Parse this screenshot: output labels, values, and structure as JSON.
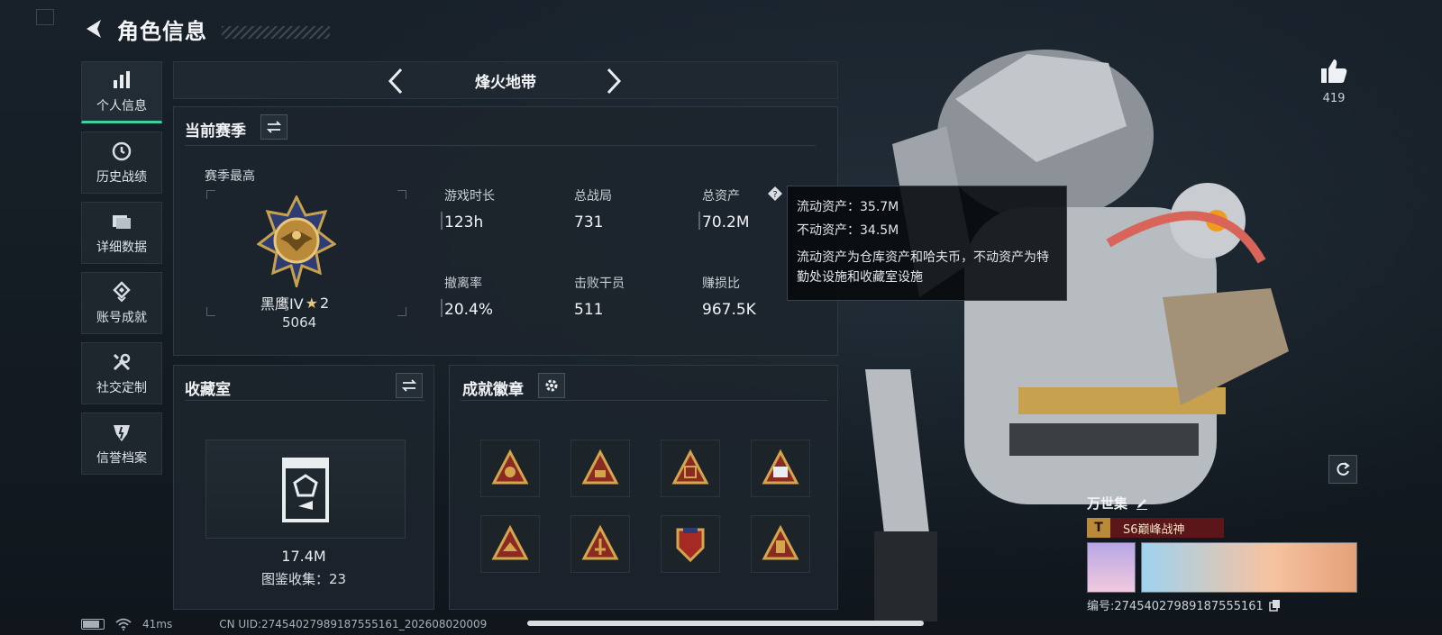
{
  "header": {
    "title": "角色信息"
  },
  "sidebar": {
    "items": [
      {
        "label": "个人信息",
        "icon": "bar-chart-icon",
        "active": true
      },
      {
        "label": "历史战绩",
        "icon": "clock-icon",
        "active": false
      },
      {
        "label": "详细数据",
        "icon": "folder-icon",
        "active": false
      },
      {
        "label": "账号成就",
        "icon": "medal-icon",
        "active": false
      },
      {
        "label": "社交定制",
        "icon": "tools-icon",
        "active": false
      },
      {
        "label": "信誉档案",
        "icon": "shield-icon",
        "active": false
      }
    ]
  },
  "mode": {
    "label": "烽火地带"
  },
  "season": {
    "title": "当前赛季",
    "best_label": "赛季最高",
    "rank_name": "黑鹰IV",
    "rank_stars": "2",
    "rank_points": "5064",
    "stats": [
      {
        "label": "游戏时长",
        "value": "123h"
      },
      {
        "label": "总战局",
        "value": "731"
      },
      {
        "label": "总资产",
        "value": "70.2M"
      },
      {
        "label": "撤离率",
        "value": "20.4%"
      },
      {
        "label": "击败干员",
        "value": "511"
      },
      {
        "label": "赚损比",
        "value": "967.5K"
      }
    ]
  },
  "tooltip": {
    "liquid": "流动资产：35.7M",
    "fixed": "不动资产：34.5M",
    "desc": "流动资产为仓库资产和哈夫币，不动资产为特勤处设施和收藏室设施"
  },
  "collection": {
    "title": "收藏室",
    "value": "17.4M",
    "count": "图鉴收集：23"
  },
  "achievements": {
    "title": "成就徽章",
    "badges": [
      "badge-1-icon",
      "badge-2-icon",
      "badge-3-icon",
      "badge-4-icon",
      "badge-5-icon",
      "badge-6-icon",
      "badge-7-icon",
      "badge-8-icon"
    ]
  },
  "profile": {
    "likes": "419",
    "name": "万世集",
    "title_tag": "S6巅峰战神",
    "uid": "编号:2745402798918755516​1"
  },
  "status": {
    "ping": "41ms",
    "uid_line": "CN UID:2745402798918755516​1_20260802​0009"
  },
  "colors": {
    "accent": "#3fd19b",
    "tag_bg": "#5a1618",
    "gold": "#c8a14e"
  }
}
